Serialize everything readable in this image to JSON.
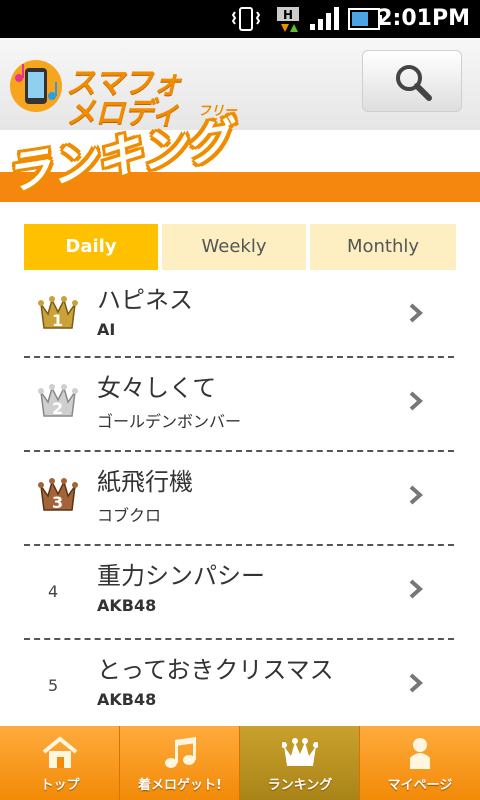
{
  "status_bar": {
    "time": "2:01PM"
  },
  "header": {
    "logo_line1": "スマフォ",
    "logo_line2": "メロディ",
    "logo_free": "フリー"
  },
  "page": {
    "title": "ランキング"
  },
  "tabs": [
    {
      "label": "Daily",
      "active": true
    },
    {
      "label": "Weekly",
      "active": false
    },
    {
      "label": "Monthly",
      "active": false
    }
  ],
  "rankings": [
    {
      "rank": "1",
      "title": "ハピネス",
      "artist": "AI",
      "badge": "gold-crown"
    },
    {
      "rank": "2",
      "title": "女々しくて",
      "artist": "ゴールデンボンバー",
      "badge": "silver-crown"
    },
    {
      "rank": "3",
      "title": "紙飛行機",
      "artist": "コブクロ",
      "badge": "bronze-crown"
    },
    {
      "rank": "4",
      "title": "重力シンパシー",
      "artist": "AKB48",
      "badge": ""
    },
    {
      "rank": "5",
      "title": "とっておきクリスマス",
      "artist": "AKB48",
      "badge": ""
    }
  ],
  "bottom_nav": [
    {
      "label": "トップ",
      "icon": "home-icon",
      "active": false
    },
    {
      "label": "着メロゲット!",
      "icon": "music-note-icon",
      "active": false
    },
    {
      "label": "ランキング",
      "icon": "crown-icon",
      "active": true
    },
    {
      "label": "マイページ",
      "icon": "person-icon",
      "active": false
    }
  ],
  "colors": {
    "accent_orange": "#f5870f",
    "tab_active": "#ffc000",
    "tab_inactive": "#fdefc2",
    "nav_active": "#b8931f"
  }
}
